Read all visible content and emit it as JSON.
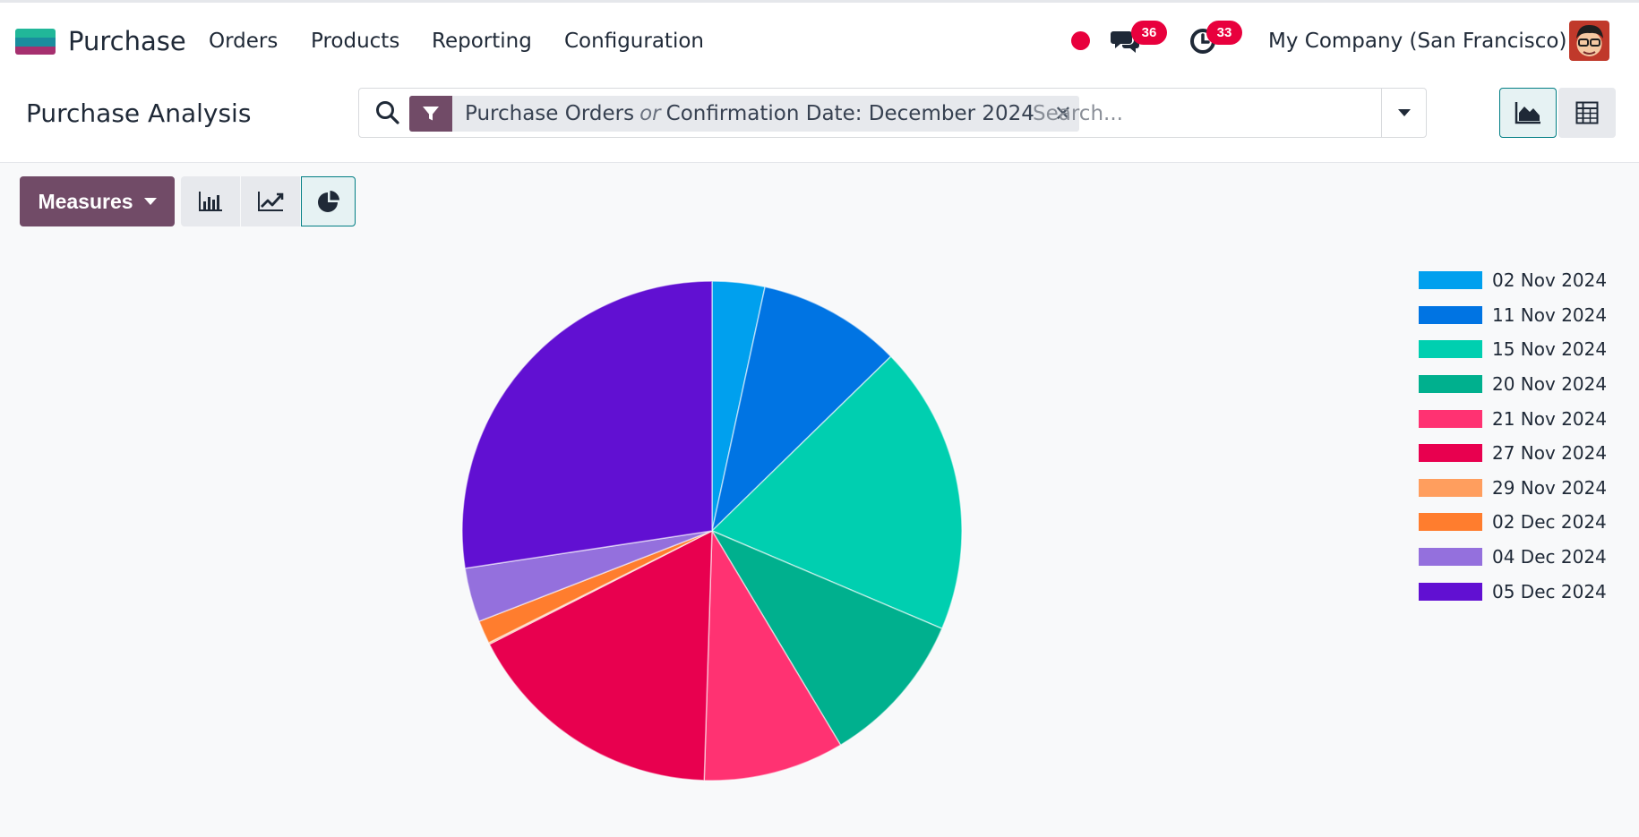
{
  "app": {
    "name": "Purchase",
    "menu": [
      "Orders",
      "Products",
      "Reporting",
      "Configuration"
    ],
    "messages_count": "36",
    "activities_count": "33",
    "company": "My Company (San Francisco)"
  },
  "control_panel": {
    "title": "Purchase Analysis",
    "facet": {
      "part1": "Purchase Orders",
      "separator": "or",
      "part2": "Confirmation Date: December 2024"
    },
    "search_placeholder": "Search..."
  },
  "toolbar": {
    "measures_label": "Measures",
    "active_chart": "pie"
  },
  "chart_data": {
    "type": "pie",
    "categories": [
      "02 Nov 2024",
      "11 Nov 2024",
      "15 Nov 2024",
      "20 Nov 2024",
      "21 Nov 2024",
      "27 Nov 2024",
      "29 Nov 2024",
      "02 Dec 2024",
      "04 Dec 2024",
      "05 Dec 2024"
    ],
    "values": [
      3.4,
      9.3,
      18.7,
      10.0,
      9.1,
      17.0,
      0.1,
      1.5,
      3.5,
      27.4
    ],
    "colors": [
      "#00a0ee",
      "#0074e3",
      "#00cfb0",
      "#00b08e",
      "#ff3272",
      "#e8004f",
      "#ff9e5e",
      "#ff7d2e",
      "#9470dd",
      "#6110d2"
    ],
    "legend_position": "right",
    "title": "",
    "xlabel": "",
    "ylabel": ""
  }
}
